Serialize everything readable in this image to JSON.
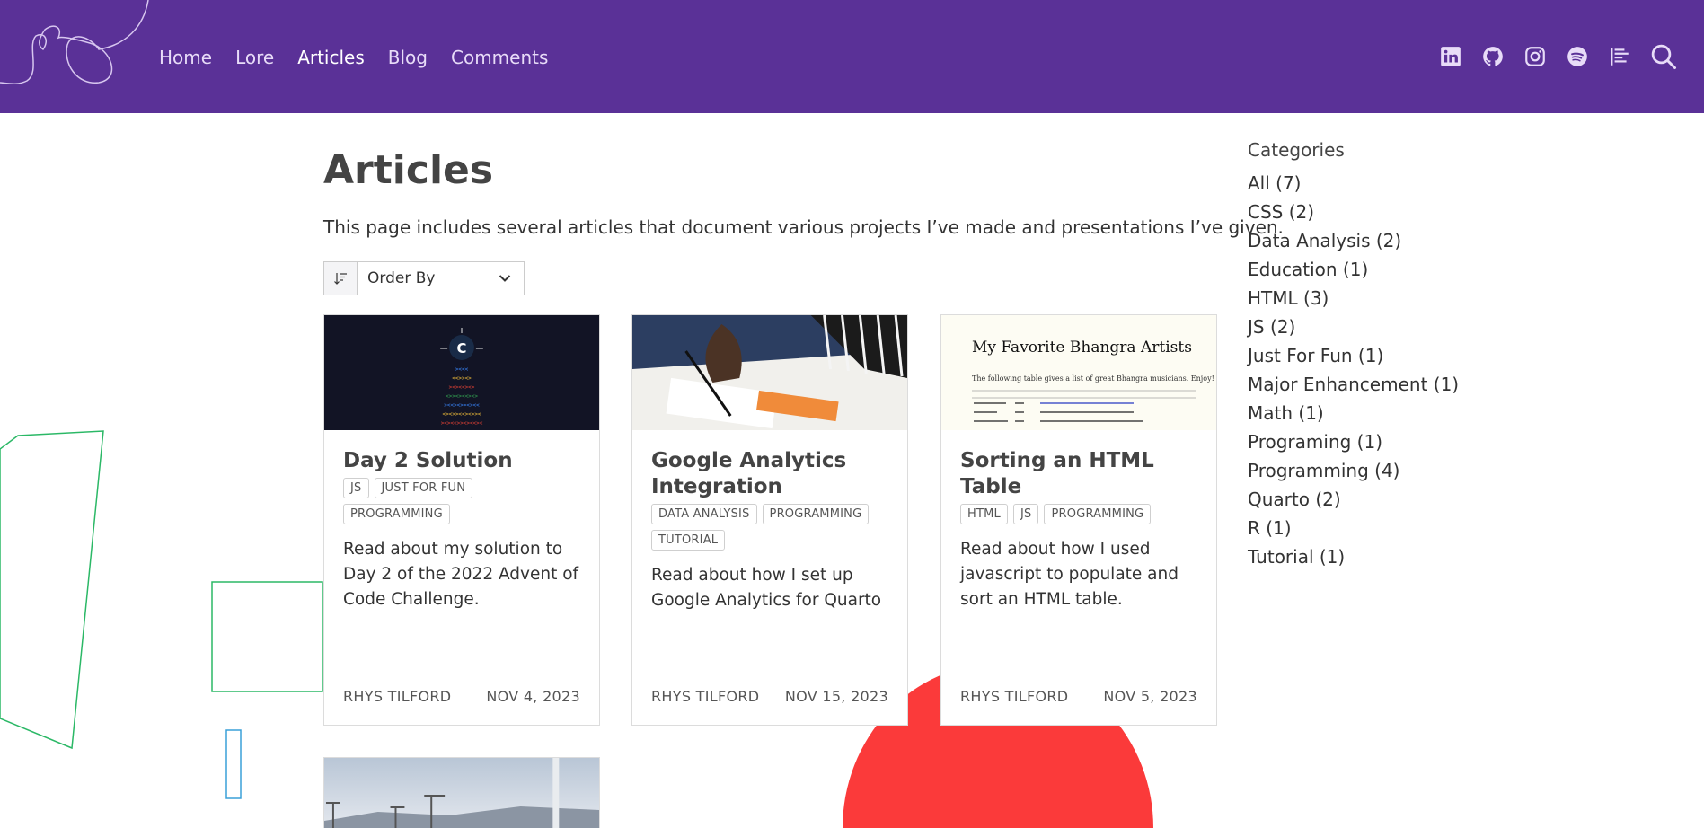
{
  "nav": {
    "links": [
      "Home",
      "Lore",
      "Articles",
      "Blog",
      "Comments"
    ],
    "icons": [
      "linkedin-icon",
      "github-icon",
      "instagram-icon",
      "spotify-icon",
      "letterboxd-icon",
      "search-icon"
    ]
  },
  "page": {
    "title": "Articles",
    "description": "This page includes several articles that document various projects I’ve made and presentations I’ve given.",
    "order_by": "Order By"
  },
  "cards": [
    {
      "title": "Day 2 Solution",
      "tags": [
        "JS",
        "JUST FOR FUN",
        "PROGRAMMING"
      ],
      "description": "Read about my solution to Day 2 of the 2022 Advent of Code Challenge.",
      "author": "RHYS TILFORD",
      "date": "NOV 4, 2023"
    },
    {
      "title": "Google Analytics Integration",
      "tags": [
        "DATA ANALYSIS",
        "PROGRAMMING",
        "TUTORIAL"
      ],
      "description": "Read about how I set up Google Analytics for Quarto",
      "author": "RHYS TILFORD",
      "date": "NOV 15, 2023"
    },
    {
      "title": "Sorting an HTML Table",
      "tags": [
        "HTML",
        "JS",
        "PROGRAMMING"
      ],
      "description": "Read about how I used javascript to populate and sort an HTML table.",
      "author": "RHYS TILFORD",
      "date": "NOV 5, 2023",
      "image_title": "My Favorite Bhangra Artists",
      "image_caption": "The following table gives a list of great Bhangra musicians. Enjoy!"
    }
  ],
  "sidebar": {
    "heading": "Categories",
    "categories": [
      "All (7)",
      "CSS (2)",
      "Data Analysis (2)",
      "Education (1)",
      "HTML (3)",
      "JS (2)",
      "Just For Fun (1)",
      "Major Enhancement (1)",
      "Math (1)",
      "Programing (1)",
      "Programming (4)",
      "Quarto (2)",
      "R (1)",
      "Tutorial (1)"
    ]
  },
  "colors": {
    "navbar": "#5a3197",
    "accent_red": "#fb3a3a",
    "deco_green": "#2bb866",
    "deco_blue": "#3aa0d8"
  }
}
